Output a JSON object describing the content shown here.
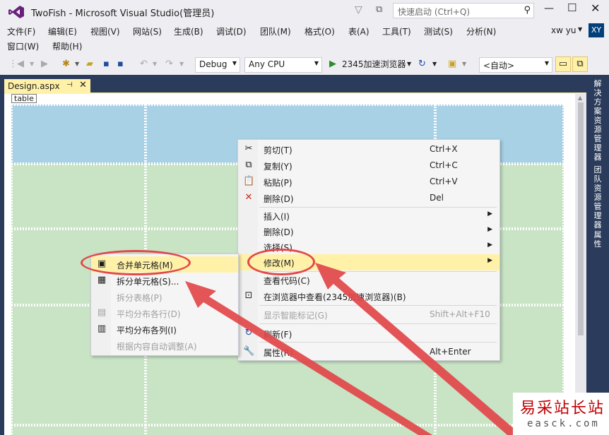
{
  "window": {
    "title": "TwoFish - Microsoft Visual Studio(管理员)"
  },
  "quick_launch": {
    "placeholder": "快速启动 (Ctrl+Q)"
  },
  "menus": [
    "文件(F)",
    "编辑(E)",
    "视图(V)",
    "网站(S)",
    "生成(B)",
    "调试(D)",
    "团队(M)",
    "格式(O)",
    "表(A)",
    "工具(T)",
    "测试(S)",
    "分析(N)",
    "窗口(W)",
    "帮助(H)"
  ],
  "user": {
    "name": "xw yu",
    "initials": "XY"
  },
  "toolbar": {
    "config": "Debug",
    "platform": "Any CPU",
    "run_label": "2345加速浏览器",
    "target": "<自动>"
  },
  "document_tab": {
    "title": "Design.aspx"
  },
  "design": {
    "tag": "table"
  },
  "side_panels": [
    "解决方案资源管理器",
    "团队资源管理器",
    "属性"
  ],
  "context_menu": {
    "items": [
      {
        "label": "剪切(T)",
        "shortcut": "Ctrl+X",
        "icon": "scissors-icon"
      },
      {
        "label": "复制(Y)",
        "shortcut": "Ctrl+C",
        "icon": "copy-icon"
      },
      {
        "label": "粘贴(P)",
        "shortcut": "Ctrl+V",
        "icon": "paste-icon"
      },
      {
        "label": "删除(D)",
        "shortcut": "Del",
        "icon": "delete-x-icon"
      },
      {
        "label": "插入(I)",
        "submenu": true
      },
      {
        "label": "删除(D)",
        "submenu": true
      },
      {
        "label": "选择(S)",
        "submenu": true
      },
      {
        "label": "修改(M)",
        "submenu": true,
        "highlighted": true
      },
      {
        "label": "查看代码(C)"
      },
      {
        "label": "在浏览器中查看(2345加速浏览器)(B)",
        "icon": "browser-icon"
      },
      {
        "label": "显示智能标记(G)",
        "shortcut": "Shift+Alt+F10",
        "disabled": true
      },
      {
        "label": "刷新(F)",
        "icon": "refresh-icon"
      },
      {
        "label": "属性(R)",
        "shortcut": "Alt+Enter",
        "icon": "wrench-icon"
      }
    ]
  },
  "submenu": {
    "items": [
      {
        "label": "合并单元格(M)",
        "highlighted": true,
        "icon": "merge-cells-icon"
      },
      {
        "label": "拆分单元格(S)...",
        "icon": "split-cells-icon"
      },
      {
        "label": "拆分表格(P)",
        "disabled": true
      },
      {
        "label": "平均分布各行(D)",
        "disabled": true,
        "icon": "distribute-rows-icon"
      },
      {
        "label": "平均分布各列(I)",
        "icon": "distribute-columns-icon"
      },
      {
        "label": "根据内容自动调整(A)",
        "disabled": true
      }
    ]
  },
  "watermark": {
    "line1": "易采站长站",
    "line2": "easck.com"
  },
  "colors": {
    "highlight": "#fff1a8",
    "annotation": "#e2474a",
    "header_cells": "#a8d1e6",
    "body_cells": "#c9e4c5"
  }
}
